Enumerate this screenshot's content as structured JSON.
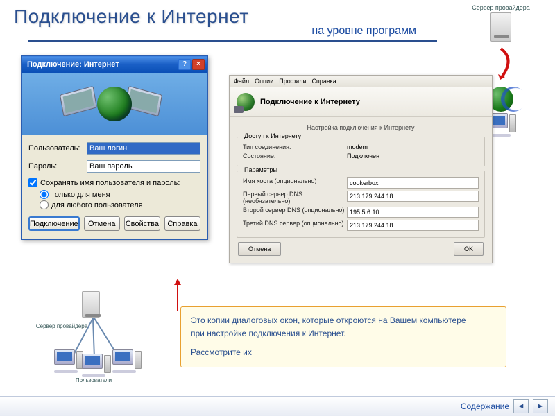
{
  "header": {
    "title": "Подключение к Интернет",
    "subtitle": "на уровне программ"
  },
  "provider_corner": {
    "label": "Сервер провайдера"
  },
  "xp_dialog": {
    "title": "Подключение: Интернет",
    "help_glyph": "?",
    "close_glyph": "×",
    "user_label": "Пользователь:",
    "user_value": "Ваш логин",
    "pass_label": "Пароль:",
    "pass_value": "Ваш пароль",
    "save_check": "Сохранять имя пользователя и пароль:",
    "radio1": "только для меня",
    "radio2": "для любого пользователя",
    "buttons": {
      "connect": "Подключение",
      "cancel": "Отмена",
      "props": "Свойства",
      "help": "Справка"
    }
  },
  "gray_dialog": {
    "menu": {
      "file": "Файл",
      "options": "Опции",
      "profiles": "Профили",
      "help": "Справка"
    },
    "title": "Подключение к Интернету",
    "section": "Настройка подключения к Интернету",
    "group_access": "Доступ к Интернету",
    "conn_type_label": "Тип соединения:",
    "conn_type_value": "modem",
    "state_label": "Состояние:",
    "state_value": "Подключен",
    "group_params": "Параметры",
    "host_label": "Имя хоста (опционально)",
    "host_value": "cookerbox",
    "dns1_label": "Первый сервер DNS (необязательно)",
    "dns1_value": "213.179.244.18",
    "dns2_label": "Второй сервер DNS (опционально)",
    "dns2_value": "195.5.6.10",
    "dns3_label": "Третий DNS сервер (опционально)",
    "dns3_value": "213.179.244.18",
    "cancel": "Отмена",
    "ok": "OK"
  },
  "explain": {
    "line1": "Это копии диалоговых окон, которые откроются на Вашем компьютере",
    "line2": "при настройке подключения к Интернет.",
    "line3": "Рассмотрите их"
  },
  "net_diagram": {
    "server_label": "Сервер провайдера",
    "users_label": "Пользователи"
  },
  "footer": {
    "toc": "Содержание",
    "prev": "◄",
    "next": "►"
  }
}
